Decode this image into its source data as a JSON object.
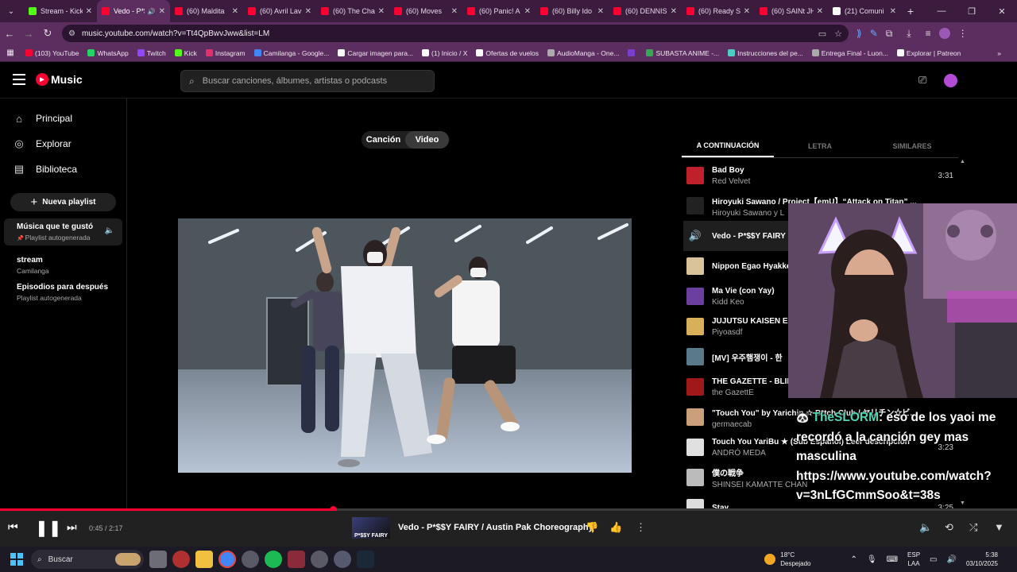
{
  "browser": {
    "tabs": [
      {
        "label": "Stream - Kick",
        "color": "#53fc18"
      },
      {
        "label": "Vedo - P*$$Y",
        "color": "#ff0033",
        "active": true
      },
      {
        "label": "(60) Maldita",
        "color": "#ff0033"
      },
      {
        "label": "(60) Avril Lav",
        "color": "#ff0033"
      },
      {
        "label": "(60) The Cha",
        "color": "#ff0033"
      },
      {
        "label": "(60) Moves",
        "color": "#ff0033"
      },
      {
        "label": "(60) Panic! A",
        "color": "#ff0033"
      },
      {
        "label": "(60) Billy Ido",
        "color": "#ff0033"
      },
      {
        "label": "(60) DENNIS",
        "color": "#ff0033"
      },
      {
        "label": "(60) Ready S",
        "color": "#ff0033"
      },
      {
        "label": "(60) SAINt JH",
        "color": "#ff0033"
      },
      {
        "label": "(21) Comuni",
        "color": "#ffffff"
      }
    ],
    "url": "music.youtube.com/watch?v=Tt4QpBwvJww&list=LM",
    "bookmarks": [
      {
        "label": "(103) YouTube",
        "color": "#ff0033"
      },
      {
        "label": "WhatsApp",
        "color": "#25d366"
      },
      {
        "label": "Twitch",
        "color": "#9146ff"
      },
      {
        "label": "Kick",
        "color": "#53fc18"
      },
      {
        "label": "Instagram",
        "color": "#e1306c"
      },
      {
        "label": "Camilanga - Google...",
        "color": "#4285f4"
      },
      {
        "label": "Cargar imagen para...",
        "color": "#ffffff"
      },
      {
        "label": "(1) Inicio / X",
        "color": "#ffffff"
      },
      {
        "label": "Ofertas de vuelos",
        "color": "#ffffff"
      },
      {
        "label": "AudioManga - One...",
        "color": "#aaaaaa"
      },
      {
        "label": "",
        "color": "#7b3fd0"
      },
      {
        "label": "SUBASTA ANIME -...",
        "color": "#34a853"
      },
      {
        "label": "Instrucciones del pe...",
        "color": "#4ecdc4"
      },
      {
        "label": "Entrega Final - Luon...",
        "color": "#aaaaaa"
      },
      {
        "label": "Explorar | Patreon",
        "color": "#ffffff"
      }
    ]
  },
  "ytm": {
    "logo": "Music",
    "search_placeholder": "Buscar canciones, álbumes, artistas o podcasts",
    "nav": [
      {
        "label": "Principal",
        "icon": "home-icon",
        "glyph": "⌂"
      },
      {
        "label": "Explorar",
        "icon": "compass-icon",
        "glyph": "◎"
      },
      {
        "label": "Biblioteca",
        "icon": "library-icon",
        "glyph": "▤"
      }
    ],
    "new_playlist": "Nueva playlist",
    "playlists": [
      {
        "title": "Música que te gustó",
        "subtitle": "Playlist autogenerada",
        "pinned": true,
        "selected": true
      },
      {
        "title": "stream",
        "subtitle": "Camilanga"
      },
      {
        "title": "Episodios para después",
        "subtitle": "Playlist autogenerada"
      }
    ],
    "toggle": {
      "song": "Canción",
      "video": "Video"
    },
    "queue_tabs": {
      "next": "A CONTINUACIÓN",
      "lyrics": "LETRA",
      "related": "SIMILARES"
    },
    "queue": [
      {
        "title": "Bad Boy",
        "artist": "Red Velvet",
        "duration": "3:31",
        "color": "#c0202a"
      },
      {
        "title": "Hiroyuki Sawano / Project【emU】“Attack on Titan” ...",
        "artist": "Hiroyuki Sawano y L",
        "duration": "",
        "color": "#222222"
      },
      {
        "title": "Vedo - P*$$Y FAIRY",
        "artist": "",
        "duration": "",
        "color": "#1f1f1f",
        "playing": true
      },
      {
        "title": "Nippon Egao Hyakkei",
        "artist": "",
        "duration": "",
        "color": "#d9c39a"
      },
      {
        "title": "Ma Vie (con Yay)",
        "artist": "Kidd Keo",
        "duration": "",
        "color": "#6b3fa0"
      },
      {
        "title": "JUJUTSU KAISEN Ed",
        "artist": "Piyoasdf",
        "duration": "",
        "color": "#d9b05a"
      },
      {
        "title": "[MV] 우주햄쟁이 - 한",
        "artist": "",
        "duration": "",
        "color": "#5a7a8a"
      },
      {
        "title": "THE GAZETTE - BLIN",
        "artist": "the GazettE",
        "duration": "",
        "color": "#a01818"
      },
      {
        "title": "\"Touch You\" by Yarichin ☆ B*tch Club / ヤリチン☆ビ...",
        "artist": "germaecab",
        "duration": "",
        "color": "#c9a07a"
      },
      {
        "title": "Touch You YariBu ★ (Sub Español) Leer descripción",
        "artist": "ANDRÓ MEDA",
        "duration": "3:23",
        "color": "#e0e0e0"
      },
      {
        "title": "僕の戦争",
        "artist": "SHINSEI KAMATTE CHAN",
        "duration": "",
        "color": "#bbbbbb"
      },
      {
        "title": "Stay",
        "artist": "",
        "duration": "3:25",
        "color": "#dddddd"
      }
    ],
    "player": {
      "time": "0:45 / 2:17",
      "progress": 0.327,
      "title": "Vedo - P*$$Y FAIRY / Austin Pak Choreography",
      "thumb_label": "P*$$Y FAIRY"
    }
  },
  "overlay": {
    "chat_user": "TheSLORM",
    "chat_message": ": eso de los yaoi me recordó a la canción gey mas masculina https://www.youtube.com/watch?v=3nLfGCmmSoo&t=38s"
  },
  "taskbar": {
    "search": "Buscar",
    "weather_temp": "18°C",
    "weather_desc": "Despejado",
    "lang1": "ESP",
    "lang2": "LAA",
    "time": "5:38",
    "date": "03/10/2025"
  }
}
